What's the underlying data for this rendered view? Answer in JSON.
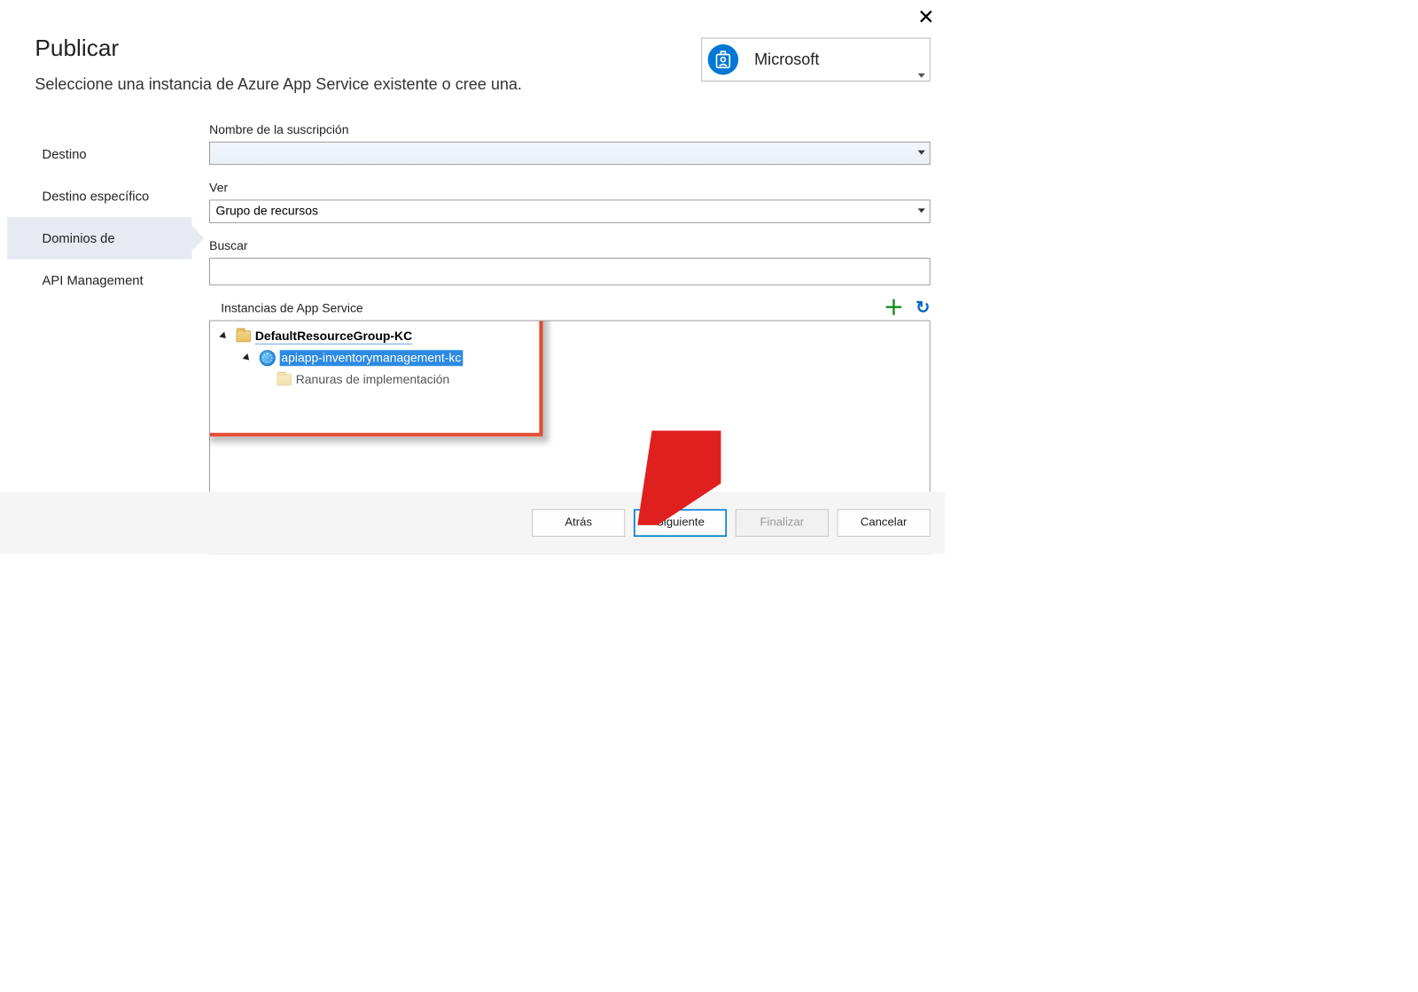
{
  "header": {
    "title": "Publicar",
    "subtitle": "Seleccione una instancia de Azure App Service existente o cree una."
  },
  "account": {
    "name": "Microsoft"
  },
  "sidebar": {
    "items": [
      {
        "label": "Destino"
      },
      {
        "label": "Destino específico"
      },
      {
        "label": "Dominios de"
      },
      {
        "label": "API Management"
      }
    ]
  },
  "fields": {
    "subscription_label": "Nombre de la suscripción",
    "subscription_value": "",
    "view_label": "Ver",
    "view_value": "Grupo de recursos",
    "search_label": "Buscar",
    "search_value": ""
  },
  "tree": {
    "label": "Instancias de App Service",
    "resource_group": "DefaultResourceGroup-KC",
    "app": "apiapp-inventorymanagement-kc",
    "slots_label": "Ranuras de implementación"
  },
  "footer": {
    "back": "Atrás",
    "next": "Siguiente",
    "finish": "Finalizar",
    "cancel": "Cancelar"
  }
}
